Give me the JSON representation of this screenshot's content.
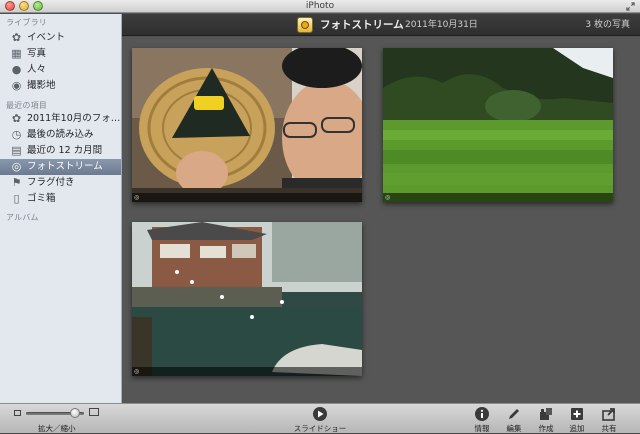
{
  "window": {
    "title": "iPhoto"
  },
  "sidebar": {
    "library_heading": "ライブラリ",
    "library_items": [
      {
        "label": "イベント",
        "icon": "events-icon"
      },
      {
        "label": "写真",
        "icon": "photos-icon"
      },
      {
        "label": "人々",
        "icon": "faces-icon"
      },
      {
        "label": "撮影地",
        "icon": "places-icon"
      }
    ],
    "recent_heading": "最近の項目",
    "recent_items": [
      {
        "label": "2011年10月のフォト…",
        "icon": "events-icon"
      },
      {
        "label": "最後の読み込み",
        "icon": "last-import-icon"
      },
      {
        "label": "最近の 12 カ月間",
        "icon": "calendar-icon"
      },
      {
        "label": "フォトストリーム",
        "icon": "photo-stream-icon",
        "selected": true
      },
      {
        "label": "フラグ付き",
        "icon": "flag-icon"
      },
      {
        "label": "ゴミ箱",
        "icon": "trash-icon"
      }
    ],
    "albums_heading": "アルバム"
  },
  "header": {
    "title": "フォトストリーム",
    "date": "2011年10月31日",
    "count": "3 枚の写真"
  },
  "toolbar": {
    "zoom_label": "拡大／縮小",
    "zoom_level": 0.85,
    "slideshow_label": "スライドショー",
    "info_label": "情報",
    "edit_label": "編集",
    "create_label": "作成",
    "add_label": "追加",
    "share_label": "共有"
  },
  "colors": {
    "sidebar_bg": "#e3e8ee",
    "selection": "#7a889e",
    "content_bg": "#565656",
    "header_bg": "#353535"
  }
}
